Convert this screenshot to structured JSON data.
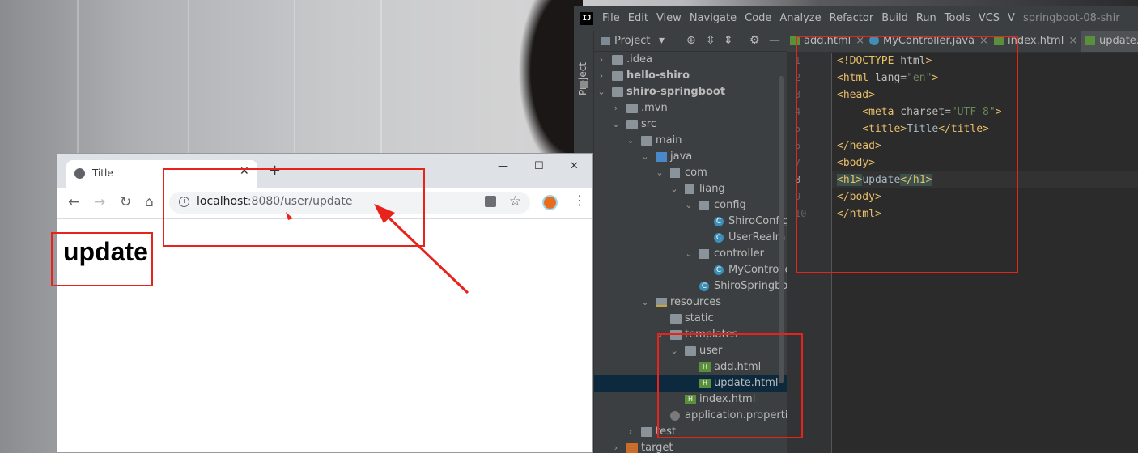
{
  "ide": {
    "menu": [
      "File",
      "Edit",
      "View",
      "Navigate",
      "Code",
      "Analyze",
      "Refactor",
      "Build",
      "Run",
      "Tools",
      "VCS",
      "V"
    ],
    "window_title": "springboot-08-shir",
    "side_label": "Project",
    "project_header": "Project",
    "tree": [
      {
        "label": ".idea"
      },
      {
        "label": "hello-shiro"
      },
      {
        "label": "shiro-springboot"
      },
      {
        "label": ".mvn"
      },
      {
        "label": "src"
      },
      {
        "label": "main"
      },
      {
        "label": "java"
      },
      {
        "label": "com"
      },
      {
        "label": "liang"
      },
      {
        "label": "config"
      },
      {
        "label": "ShiroConfig"
      },
      {
        "label": "UserRealm"
      },
      {
        "label": "controller"
      },
      {
        "label": "MyControlle"
      },
      {
        "label": "ShiroSpringboo"
      },
      {
        "label": "resources"
      },
      {
        "label": "static"
      },
      {
        "label": "templates"
      },
      {
        "label": "user"
      },
      {
        "label": "add.html"
      },
      {
        "label": "update.html"
      },
      {
        "label": "index.html"
      },
      {
        "label": "application.properties"
      },
      {
        "label": "test"
      },
      {
        "label": "target"
      }
    ],
    "tabs": [
      {
        "label": "add.html"
      },
      {
        "label": "MyController.java"
      },
      {
        "label": "index.html"
      },
      {
        "label": "update.h"
      }
    ],
    "line_numbers": [
      "1",
      "2",
      "3",
      "4",
      "5",
      "6",
      "7",
      "8",
      "9",
      "10"
    ],
    "code": {
      "l1a": "<!DOCTYPE",
      "l1b": " html",
      "l1c": ">",
      "l2a": "<html ",
      "l2b": "lang=",
      "l2c": "\"en\"",
      "l2d": ">",
      "l3": "<head>",
      "l4a": "<meta ",
      "l4b": "charset=",
      "l4c": "\"UTF-8\"",
      "l4d": ">",
      "l5a": "<title>",
      "l5b": "Title",
      "l5c": "</title>",
      "l6": "</head>",
      "l7": "<body>",
      "l8a": "<h1>",
      "l8b": "update",
      "l8c": "</h1>",
      "l9": "</body>",
      "l10": "</html>"
    }
  },
  "browser": {
    "tab_title": "Title",
    "url_host": "localhost",
    "url_rest": ":8080/user/update",
    "page_heading": "update"
  },
  "colors": {
    "annotation": "#e8231c",
    "ide_bg": "#2b2b2b"
  }
}
